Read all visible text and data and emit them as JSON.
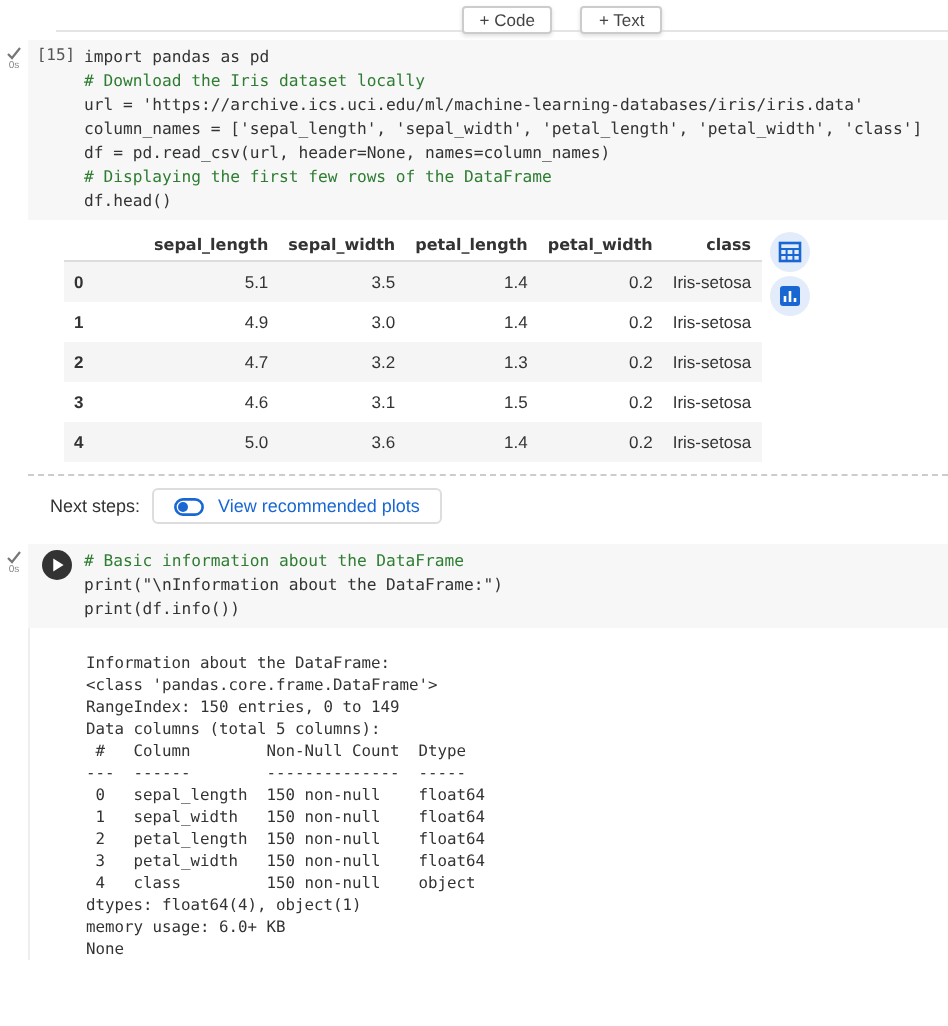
{
  "toolbar": {
    "buttons": [
      "+ Code",
      "+ Text"
    ]
  },
  "cells": [
    {
      "done": true,
      "time": "0s",
      "execution_count": "[15]",
      "run_button": false,
      "code": [
        {
          "kind": "code",
          "text": "import pandas as pd"
        },
        {
          "kind": "comment",
          "text": "# Download the Iris dataset locally"
        },
        {
          "kind": "code",
          "text": "url = 'https://archive.ics.uci.edu/ml/machine-learning-databases/iris/iris.data'"
        },
        {
          "kind": "code",
          "text": "column_names = ['sepal_length', 'sepal_width', 'petal_length', 'petal_width', 'class']"
        },
        {
          "kind": "code",
          "text": "df = pd.read_csv(url, header=None, names=column_names)"
        },
        {
          "kind": "comment",
          "text": "# Displaying the first few rows of the DataFrame"
        },
        {
          "kind": "code",
          "text": "df.head()"
        }
      ],
      "output": {
        "kind": "table",
        "columns": [
          "",
          "sepal_length",
          "sepal_width",
          "petal_length",
          "petal_width",
          "class"
        ],
        "rows": [
          [
            "0",
            "5.1",
            "3.5",
            "1.4",
            "0.2",
            "Iris-setosa"
          ],
          [
            "1",
            "4.9",
            "3.0",
            "1.4",
            "0.2",
            "Iris-setosa"
          ],
          [
            "2",
            "4.7",
            "3.2",
            "1.3",
            "0.2",
            "Iris-setosa"
          ],
          [
            "3",
            "4.6",
            "3.1",
            "1.5",
            "0.2",
            "Iris-setosa"
          ],
          [
            "4",
            "5.0",
            "3.6",
            "1.4",
            "0.2",
            "Iris-setosa"
          ]
        ],
        "next_steps": {
          "label": "Next steps:",
          "button": "View recommended plots"
        }
      }
    },
    {
      "done": true,
      "time": "0s",
      "run_button": true,
      "code": [
        {
          "kind": "comment",
          "text": "# Basic information about the DataFrame"
        },
        {
          "kind": "code",
          "text": "print(\"\\nInformation about the DataFrame:\")"
        },
        {
          "kind": "code",
          "text": "print(df.info())"
        }
      ],
      "output": {
        "kind": "text",
        "lines": [
          "Information about the DataFrame:",
          "<class 'pandas.core.frame.DataFrame'>",
          "RangeIndex: 150 entries, 0 to 149",
          "Data columns (total 5 columns):",
          " #   Column        Non-Null Count  Dtype  ",
          "---  ------        --------------  -----  ",
          " 0   sepal_length  150 non-null    float64",
          " 1   sepal_width   150 non-null    float64",
          " 2   petal_length  150 non-null    float64",
          " 3   petal_width   150 non-null    float64",
          " 4   class         150 non-null    object ",
          "dtypes: float64(4), object(1)",
          "memory usage: 6.0+ KB",
          "None"
        ]
      }
    }
  ]
}
